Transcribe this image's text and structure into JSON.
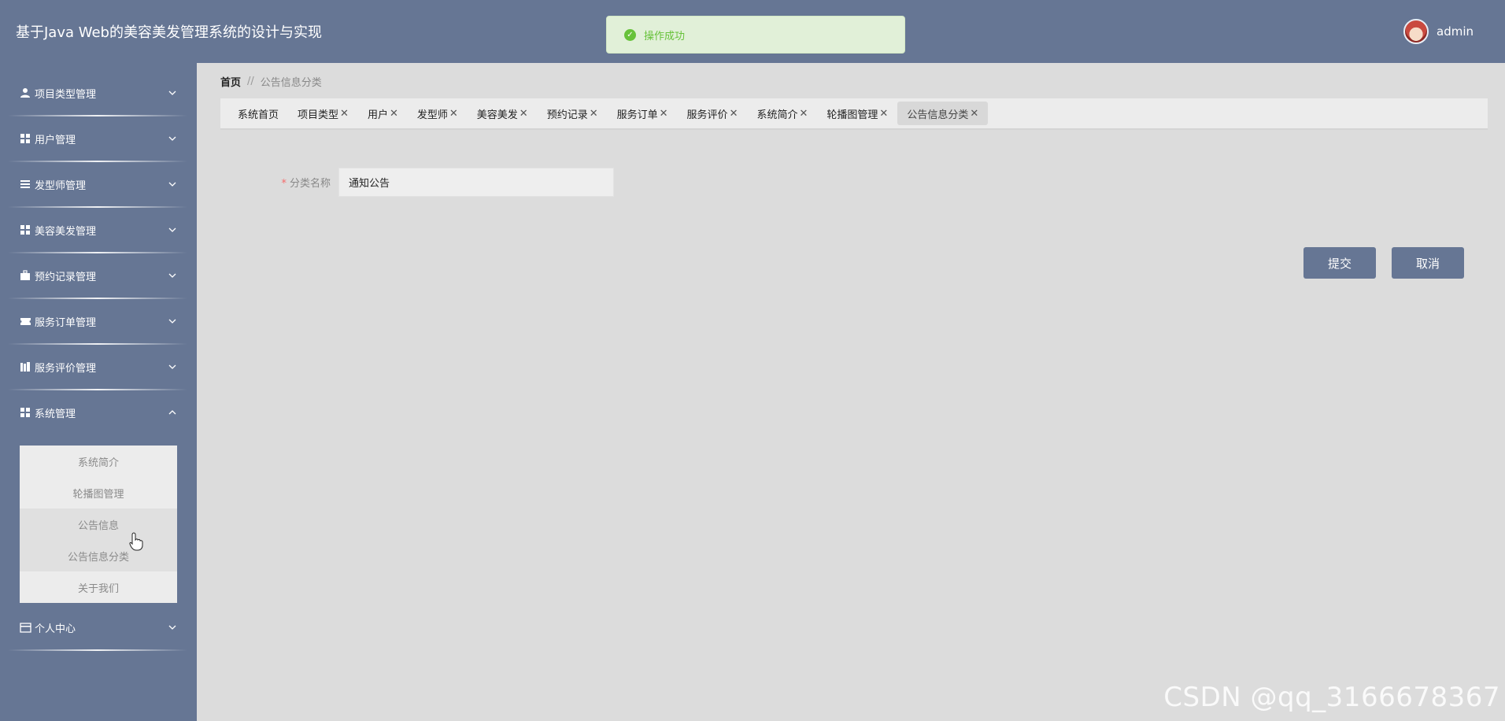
{
  "header": {
    "title": "基于Java Web的美容美发管理系统的设计与实现",
    "user_name": "admin",
    "bg_color": "#667694"
  },
  "toast": {
    "message": "操作成功",
    "status_color": "#67c23a"
  },
  "sidebar": {
    "items": [
      {
        "label": "项目类型管理",
        "icon": "user-icon",
        "expanded": false
      },
      {
        "label": "用户管理",
        "icon": "grid-icon",
        "expanded": false
      },
      {
        "label": "发型师管理",
        "icon": "list-icon",
        "expanded": false
      },
      {
        "label": "美容美发管理",
        "icon": "grid-icon",
        "expanded": false
      },
      {
        "label": "预约记录管理",
        "icon": "briefcase-icon",
        "expanded": false
      },
      {
        "label": "服务订单管理",
        "icon": "ticket-icon",
        "expanded": false
      },
      {
        "label": "服务评价管理",
        "icon": "books-icon",
        "expanded": false
      },
      {
        "label": "系统管理",
        "icon": "grid-icon",
        "expanded": true
      },
      {
        "label": "个人中心",
        "icon": "card-icon",
        "expanded": false
      }
    ],
    "submenu": [
      {
        "label": "系统简介"
      },
      {
        "label": "轮播图管理"
      },
      {
        "label": "公告信息"
      },
      {
        "label": "公告信息分类",
        "active": true
      },
      {
        "label": "关于我们"
      }
    ]
  },
  "breadcrumb": {
    "home": "首页",
    "separator": "//",
    "current": "公告信息分类"
  },
  "tabs": [
    {
      "label": "系统首页",
      "closable": false
    },
    {
      "label": "项目类型",
      "closable": true
    },
    {
      "label": "用户",
      "closable": true
    },
    {
      "label": "发型师",
      "closable": true
    },
    {
      "label": "美容美发",
      "closable": true
    },
    {
      "label": "预约记录",
      "closable": true
    },
    {
      "label": "服务订单",
      "closable": true
    },
    {
      "label": "服务评价",
      "closable": true
    },
    {
      "label": "系统简介",
      "closable": true
    },
    {
      "label": "轮播图管理",
      "closable": true
    },
    {
      "label": "公告信息分类",
      "closable": true,
      "active": true
    }
  ],
  "form": {
    "required_mark": "*",
    "label": "分类名称",
    "value": "通知公告"
  },
  "buttons": {
    "submit": "提交",
    "cancel": "取消"
  },
  "watermark": "CSDN @qq_3166678367"
}
